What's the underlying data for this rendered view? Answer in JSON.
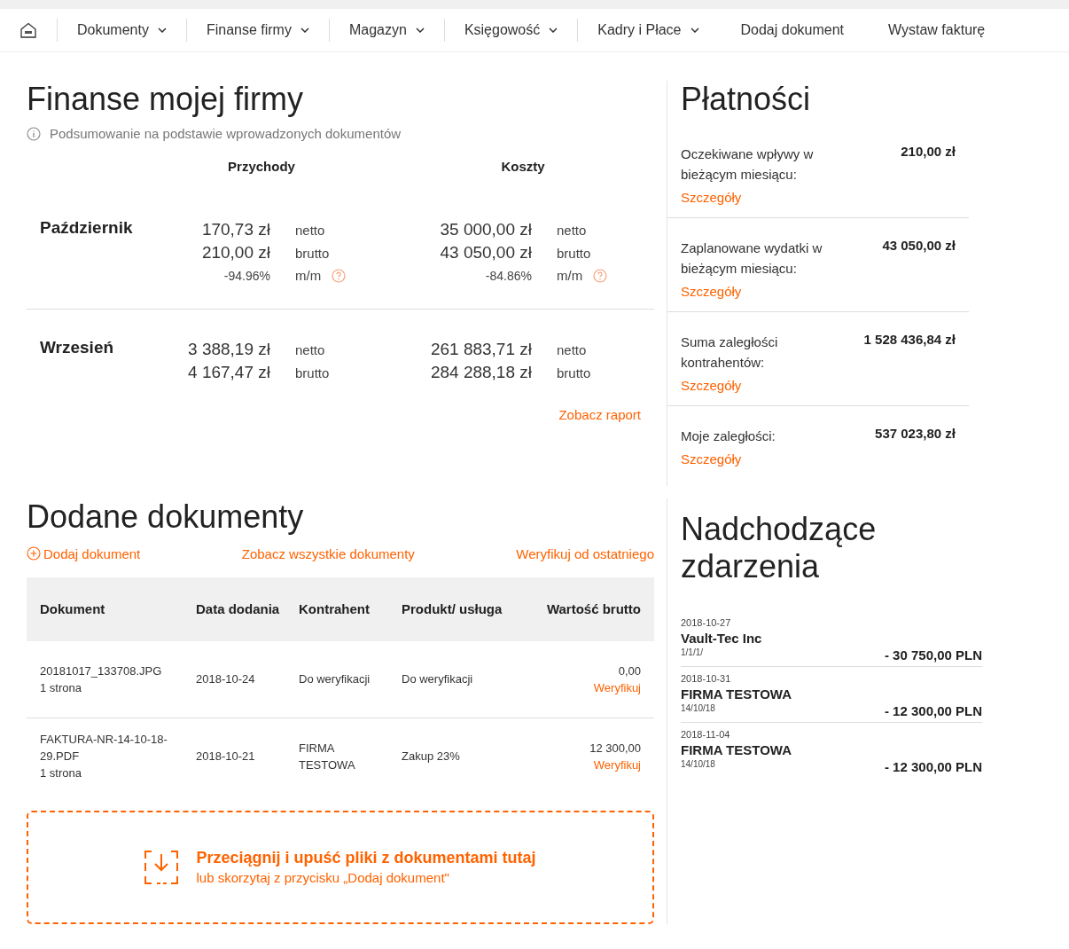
{
  "nav": {
    "items": [
      {
        "label": "Dokumenty",
        "dropdown": true
      },
      {
        "label": "Finanse firmy",
        "dropdown": true
      },
      {
        "label": "Magazyn",
        "dropdown": true
      },
      {
        "label": "Księgowość",
        "dropdown": true
      },
      {
        "label": "Kadry i Płace",
        "dropdown": true
      },
      {
        "label": "Dodaj dokument",
        "dropdown": false
      },
      {
        "label": "Wystaw fakturę",
        "dropdown": false
      }
    ]
  },
  "finance": {
    "title": "Finanse mojej firmy",
    "subtitle": "Podsumowanie na podstawie wprowadzonych dokumentów",
    "columns": [
      "Przychody",
      "Koszty"
    ],
    "periods": [
      {
        "month": "Październik",
        "groups": [
          {
            "lines": [
              {
                "value": "170,73 zł",
                "label": "netto"
              },
              {
                "value": "210,00 zł",
                "label": "brutto"
              }
            ],
            "change": "-94.96%",
            "change_label": "m/m"
          },
          {
            "lines": [
              {
                "value": "35 000,00 zł",
                "label": "netto"
              },
              {
                "value": "43 050,00 zł",
                "label": "brutto"
              }
            ],
            "change": "-84.86%",
            "change_label": "m/m"
          }
        ]
      },
      {
        "month": "Wrzesień",
        "groups": [
          {
            "lines": [
              {
                "value": "3 388,19 zł",
                "label": "netto"
              },
              {
                "value": "4 167,47 zł",
                "label": "brutto"
              }
            ]
          },
          {
            "lines": [
              {
                "value": "261 883,71 zł",
                "label": "netto"
              },
              {
                "value": "284 288,18 zł",
                "label": "brutto"
              }
            ]
          }
        ]
      }
    ],
    "report_link": "Zobacz raport"
  },
  "payments": {
    "title": "Płatności",
    "items": [
      {
        "label": "Oczekiwane wpływy w bieżącym miesiącu:",
        "amount": "210,00 zł",
        "link": "Szczegóły"
      },
      {
        "label": "Zaplanowane wydatki w bieżącym miesiącu:",
        "amount": "43 050,00 zł",
        "link": "Szczegóły"
      },
      {
        "label": "Suma zaległości kontrahentów:",
        "amount": "1 528 436,84 zł",
        "link": "Szczegóły"
      },
      {
        "label": "Moje zaległości:",
        "amount": "537 023,80 zł",
        "link": "Szczegóły"
      }
    ]
  },
  "documents": {
    "title": "Dodane dokumenty",
    "actions": [
      {
        "label": "Dodaj dokument",
        "kind": "add"
      },
      {
        "label": "Zobacz wszystkie dokumenty",
        "kind": "link"
      },
      {
        "label": "Weryfikuj od ostatniego",
        "kind": "link"
      }
    ],
    "table": {
      "columns": [
        "Dokument",
        "Data dodania",
        "Kontrahent",
        "Produkt/ usługa",
        "Wartość brutto"
      ],
      "rows": [
        {
          "document": "20181017_133708.JPG",
          "pages": "1 strona",
          "date": "2018-10-24",
          "contractor": "Do weryfikacji",
          "product": "Do weryfikacji",
          "value": "0,00",
          "action": "Weryfikuj"
        },
        {
          "document": "FAKTURA-NR-14-10-18-29.PDF",
          "pages": "1 strona",
          "date": "2018-10-21",
          "contractor": "FIRMA TESTOWA",
          "product": "Zakup 23%",
          "value": "12 300,00",
          "action": "Weryfikuj"
        }
      ]
    },
    "dropzone": {
      "title": "Przeciągnij i upuść pliki z dokumentami tutaj",
      "subtitle": "lub skorzytaj z przycisku „Dodaj dokument\""
    }
  },
  "events": {
    "title": "Nadchodzące zdarzenia",
    "items": [
      {
        "date": "2018-10-27",
        "name": "Vault-Tec Inc",
        "ref": "1/1/1/",
        "amount": "- 30 750,00 PLN"
      },
      {
        "date": "2018-10-31",
        "name": "FIRMA TESTOWA",
        "ref": "14/10/18",
        "amount": "- 12 300,00 PLN"
      },
      {
        "date": "2018-11-04",
        "name": "FIRMA TESTOWA",
        "ref": "14/10/18",
        "amount": "- 12 300,00 PLN"
      }
    ]
  }
}
